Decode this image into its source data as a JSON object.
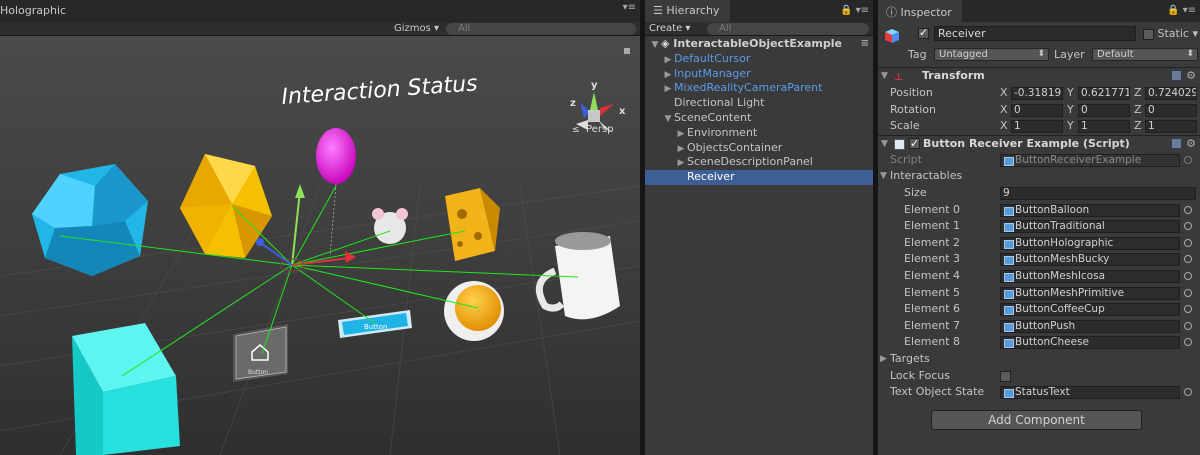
{
  "scene": {
    "title": "Holographic",
    "gizmos_label": "Gizmos",
    "search_placeholder": "All",
    "overlay_text": "Interaction Status",
    "persp_label": "Persp",
    "button_label": "Button",
    "button_icon_text": "Button",
    "axis_x": "x",
    "axis_y": "y",
    "axis_z": "z"
  },
  "hierarchy": {
    "tab_label": "Hierarchy",
    "create_label": "Create",
    "search_placeholder": "All",
    "items": [
      {
        "label": "InteractableObjectExample",
        "depth": 0,
        "arrow": "▼",
        "style": "scene"
      },
      {
        "label": "DefaultCursor",
        "depth": 1,
        "arrow": "▶",
        "style": "blue"
      },
      {
        "label": "InputManager",
        "depth": 1,
        "arrow": "▶",
        "style": "blue"
      },
      {
        "label": "MixedRealityCameraParent",
        "depth": 1,
        "arrow": "▶",
        "style": "blue"
      },
      {
        "label": "Directional Light",
        "depth": 1,
        "arrow": "",
        "style": "normal"
      },
      {
        "label": "SceneContent",
        "depth": 1,
        "arrow": "▼",
        "style": "normal"
      },
      {
        "label": "Environment",
        "depth": 2,
        "arrow": "▶",
        "style": "normal"
      },
      {
        "label": "ObjectsContainer",
        "depth": 2,
        "arrow": "▶",
        "style": "normal"
      },
      {
        "label": "SceneDescriptionPanel",
        "depth": 2,
        "arrow": "▶",
        "style": "normal"
      },
      {
        "label": "Receiver",
        "depth": 2,
        "arrow": "",
        "style": "selected"
      }
    ]
  },
  "inspector": {
    "tab_label": "Inspector",
    "object_name": "Receiver",
    "static_label": "Static",
    "tag_label": "Tag",
    "tag_value": "Untagged",
    "layer_label": "Layer",
    "layer_value": "Default",
    "transform": {
      "title": "Transform",
      "position_label": "Position",
      "rotation_label": "Rotation",
      "scale_label": "Scale",
      "position": {
        "x": "-0.31819",
        "y": "0.621771",
        "z": "0.724029"
      },
      "rotation": {
        "x": "0",
        "y": "0",
        "z": "0"
      },
      "scale": {
        "x": "1",
        "y": "1",
        "z": "1"
      }
    },
    "script_component": {
      "title": "Button Receiver Example (Script)",
      "script_label": "Script",
      "script_value": "ButtonReceiverExample",
      "interactables_label": "Interactables",
      "size_label": "Size",
      "size_value": "9",
      "elements": [
        {
          "label": "Element 0",
          "value": "ButtonBalloon"
        },
        {
          "label": "Element 1",
          "value": "ButtonTraditional"
        },
        {
          "label": "Element 2",
          "value": "ButtonHolographic"
        },
        {
          "label": "Element 3",
          "value": "ButtonMeshBucky"
        },
        {
          "label": "Element 4",
          "value": "ButtonMeshIcosa"
        },
        {
          "label": "Element 5",
          "value": "ButtonMeshPrimitive"
        },
        {
          "label": "Element 6",
          "value": "ButtonCoffeeCup"
        },
        {
          "label": "Element 7",
          "value": "ButtonPush"
        },
        {
          "label": "Element 8",
          "value": "ButtonCheese"
        }
      ],
      "targets_label": "Targets",
      "lock_focus_label": "Lock Focus",
      "text_object_state_label": "Text Object State",
      "text_object_state_value": "StatusText"
    },
    "add_component_label": "Add Component"
  },
  "icons": [
    "menu-icon",
    "lock-icon",
    "search-icon",
    "gear-icon",
    "scene-gizmo-icon",
    "cube-icon",
    "script-icon",
    "help-icon",
    "target-icon"
  ]
}
